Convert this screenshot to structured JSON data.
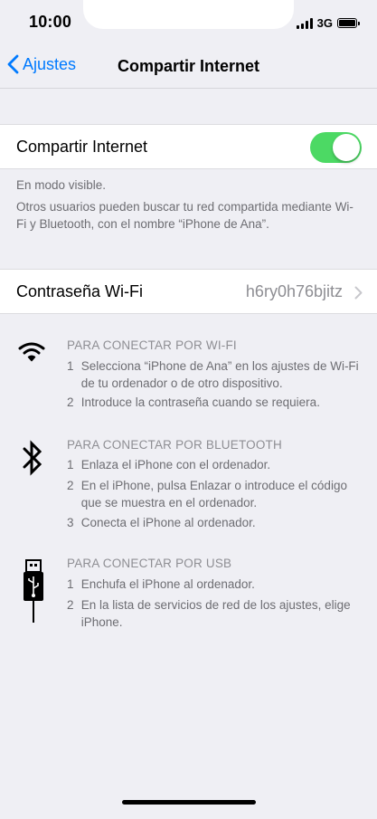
{
  "status": {
    "time": "10:00",
    "network": "3G"
  },
  "nav": {
    "back_label": "Ajustes",
    "title": "Compartir Internet"
  },
  "hotspot": {
    "label": "Compartir Internet",
    "enabled": true,
    "toggle_color": "#4cd964"
  },
  "info": {
    "visible": "En modo visible.",
    "description": "Otros usuarios pueden buscar tu red compartida mediante Wi-Fi y Bluetooth, con el nombre “iPhone de Ana”."
  },
  "password": {
    "label": "Contraseña Wi-Fi",
    "value": "h6ry0h76bjitz"
  },
  "instructions": {
    "wifi": {
      "title": "PARA CONECTAR POR WI-FI",
      "steps": [
        {
          "num": "1",
          "text": "Selecciona “iPhone de Ana” en los ajustes de Wi-Fi de tu ordenador o de otro dispositivo."
        },
        {
          "num": "2",
          "text": "Introduce la contraseña cuando se requiera."
        }
      ]
    },
    "bluetooth": {
      "title": "PARA CONECTAR POR BLUETOOTH",
      "steps": [
        {
          "num": "1",
          "text": "Enlaza el iPhone con el ordenador."
        },
        {
          "num": "2",
          "text": "En el iPhone, pulsa Enlazar o introduce el código que se muestra en el ordenador."
        },
        {
          "num": "3",
          "text": "Conecta el iPhone al ordenador."
        }
      ]
    },
    "usb": {
      "title": "PARA CONECTAR POR USB",
      "steps": [
        {
          "num": "1",
          "text": "Enchufa el iPhone al ordenador."
        },
        {
          "num": "2",
          "text": "En la lista de servicios de red de los ajustes, elige iPhone."
        }
      ]
    }
  },
  "colors": {
    "accent": "#007aff",
    "background": "#efeff4",
    "secondary_text": "#6d6d72"
  }
}
